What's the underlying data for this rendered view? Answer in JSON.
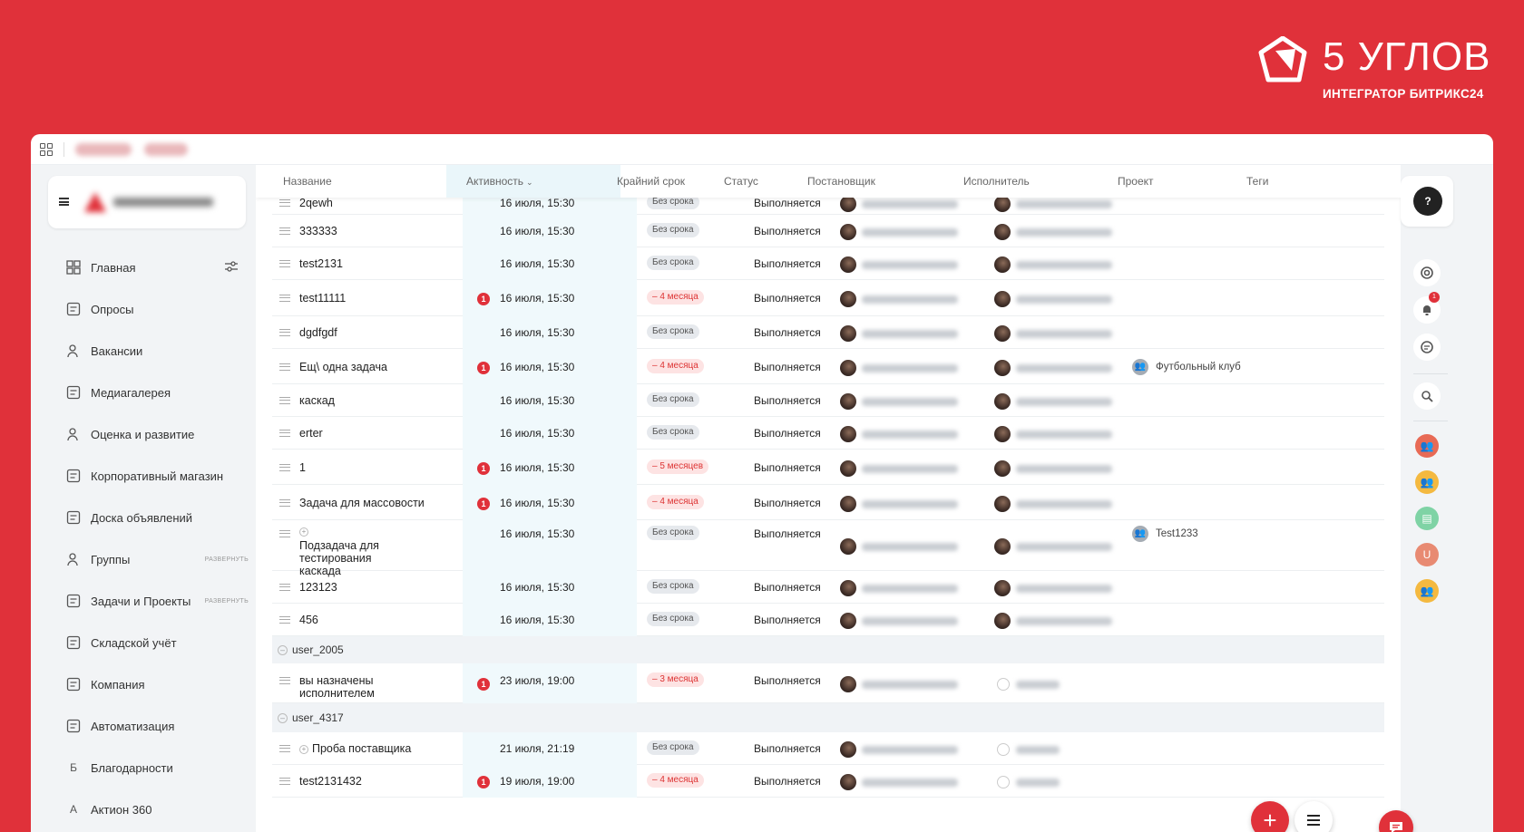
{
  "brand": {
    "name": "5 УГЛОВ",
    "subtitle": "ИНТЕГРАТОР БИТРИКС24"
  },
  "sidebar": {
    "items": [
      {
        "label": "Главная",
        "icon": "home-grid-icon"
      },
      {
        "label": "Опросы",
        "icon": "survey-icon"
      },
      {
        "label": "Вакансии",
        "icon": "person-search-icon"
      },
      {
        "label": "Медиагалерея",
        "icon": "image-icon"
      },
      {
        "label": "Оценка и развитие",
        "icon": "people-icon"
      },
      {
        "label": "Корпоративный магазин",
        "icon": "cart-icon"
      },
      {
        "label": "Доска объявлений",
        "icon": "calendar-edit-icon"
      },
      {
        "label": "Группы",
        "icon": "group-icon",
        "expand": "РАЗВЕРНУТЬ"
      },
      {
        "label": "Задачи и Проекты",
        "icon": "task-list-icon",
        "expand": "РАЗВЕРНУТЬ"
      },
      {
        "label": "Складской учёт",
        "icon": "warehouse-icon"
      },
      {
        "label": "Компания",
        "icon": "company-icon"
      },
      {
        "label": "Автоматизация",
        "icon": "automation-icon"
      },
      {
        "label": "Благодарности",
        "icon": "letter-b-icon",
        "glyph": "Б"
      },
      {
        "label": "Актион 360",
        "icon": "letter-a-icon",
        "glyph": "А"
      }
    ]
  },
  "table": {
    "columns": [
      "Название",
      "Активность",
      "Крайний срок",
      "Статус",
      "Постановщик",
      "Исполнитель",
      "Проект",
      "Теги"
    ],
    "rows": [
      {
        "name": "2qewh",
        "activity": "16 июля, 15:30",
        "deadline": "Без срока",
        "status": "Выполняется"
      },
      {
        "name": "333333",
        "activity": "16 июля, 15:30",
        "deadline": "Без срока",
        "status": "Выполняется"
      },
      {
        "name": "test2131",
        "activity": "16 июля, 15:30",
        "deadline": "Без срока",
        "status": "Выполняется"
      },
      {
        "name": "test11111",
        "badge": "1",
        "activity": "16 июля, 15:30",
        "deadline": "– 4 месяца",
        "status": "Выполняется"
      },
      {
        "name": "dgdfgdf",
        "activity": "16 июля, 15:30",
        "deadline": "Без срока",
        "status": "Выполняется"
      },
      {
        "name": "Ещ\\ одна задача",
        "badge": "1",
        "activity": "16 июля, 15:30",
        "deadline": "– 4 месяца",
        "status": "Выполняется",
        "project": "Футбольный клуб"
      },
      {
        "name": "каскад",
        "activity": "16 июля, 15:30",
        "deadline": "Без срока",
        "status": "Выполняется"
      },
      {
        "name": "erter",
        "activity": "16 июля, 15:30",
        "deadline": "Без срока",
        "status": "Выполняется"
      },
      {
        "name": "1",
        "badge": "1",
        "activity": "16 июля, 15:30",
        "deadline": "– 5 месяцев",
        "status": "Выполняется"
      },
      {
        "name": "Задача для массовости",
        "badge": "1",
        "activity": "16 июля, 15:30",
        "deadline": "– 4 месяца",
        "status": "Выполняется"
      },
      {
        "name": "Подзадача для тестирования каскада",
        "activity": "16 июля, 15:30",
        "deadline": "Без срока",
        "status": "Выполняется",
        "project": "Test1233"
      },
      {
        "name": "123123",
        "activity": "16 июля, 15:30",
        "deadline": "Без срока",
        "status": "Выполняется"
      },
      {
        "name": "456",
        "activity": "16 июля, 15:30",
        "deadline": "Без срока",
        "status": "Выполняется"
      }
    ],
    "groups": [
      {
        "name": "user_2005",
        "rows": [
          {
            "name": "вы назначены исполнителем",
            "badge": "1",
            "activity": "23 июля, 19:00",
            "deadline": "– 3 месяца",
            "status": "Выполняется"
          }
        ]
      },
      {
        "name": "user_4317",
        "rows": [
          {
            "name": "Проба поставщика",
            "activity": "21 июля, 21:19",
            "deadline": "Без срока",
            "status": "Выполняется"
          },
          {
            "name": "test2131432",
            "badge": "1",
            "activity": "19 июля, 19:00",
            "deadline": "– 4 месяца",
            "status": "Выполняется"
          }
        ]
      }
    ]
  },
  "rail": {
    "help": "?",
    "notification_count": "1",
    "avatar_letter": "U"
  },
  "colors": {
    "brand_red": "#e0313a",
    "overdue": "#d33",
    "activity_bg": "#f0f9fc"
  }
}
